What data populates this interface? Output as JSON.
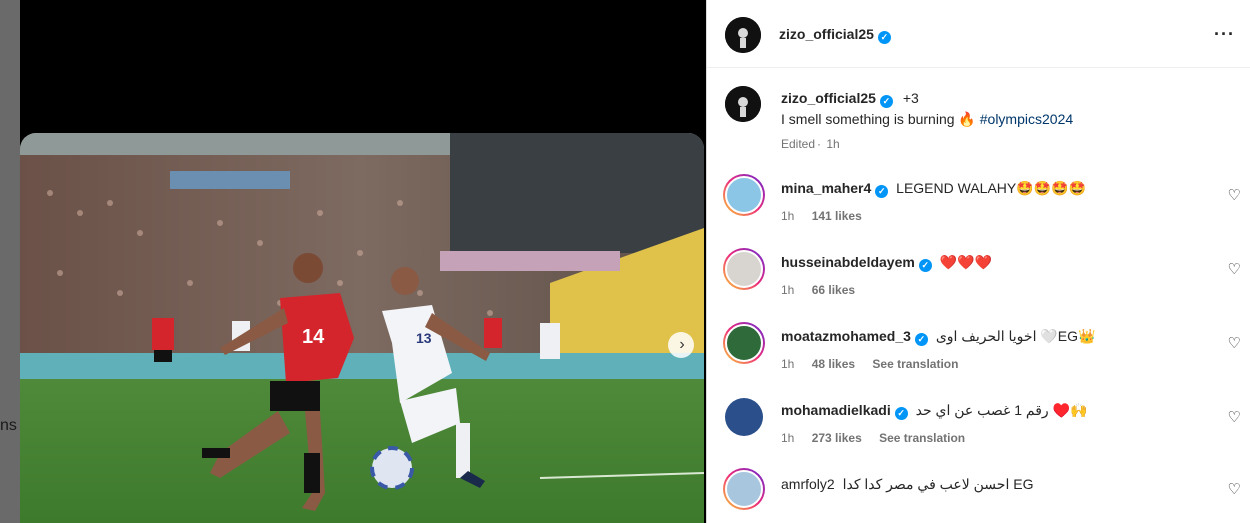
{
  "backdrop": {
    "partial_text": "ns"
  },
  "post": {
    "author": "zizo_official25",
    "collaborators": "+3",
    "caption": "I smell something is burning",
    "caption_emoji": "🔥",
    "hashtag": "#olympics2024",
    "edited_label": "Edited",
    "time": "1h",
    "jersey_left": "14",
    "jersey_right": "13"
  },
  "comments": [
    {
      "user": "mina_maher4",
      "text": "LEGEND WALAHY🤩🤩🤩🤩",
      "time": "1h",
      "likes": "141 likes",
      "see_translation": ""
    },
    {
      "user": "husseinabdeldayem",
      "text": "❤️❤️❤️",
      "time": "1h",
      "likes": "66 likes",
      "see_translation": ""
    },
    {
      "user": "moatazmohamed_3",
      "text": "اخويا الحريف اوى 🤍EG👑",
      "time": "1h",
      "likes": "48 likes",
      "see_translation": "See translation"
    },
    {
      "user": "mohamadielkadi",
      "text": "رقم 1 غصب عن اي حد ♥️🙌",
      "time": "1h",
      "likes": "273 likes",
      "see_translation": "See translation"
    },
    {
      "user": "amrfoly2",
      "text": "احسن لاعب في مصر كدا كدا EG",
      "time": "",
      "likes": "",
      "see_translation": ""
    }
  ],
  "icons": {
    "more": "more-options-icon",
    "next": "chevron-right-icon",
    "like": "heart-outline-icon",
    "verified": "verified-badge-icon"
  },
  "colors": {
    "verified": "#0095f6",
    "hashtag": "#00376b",
    "meta": "#737373"
  }
}
